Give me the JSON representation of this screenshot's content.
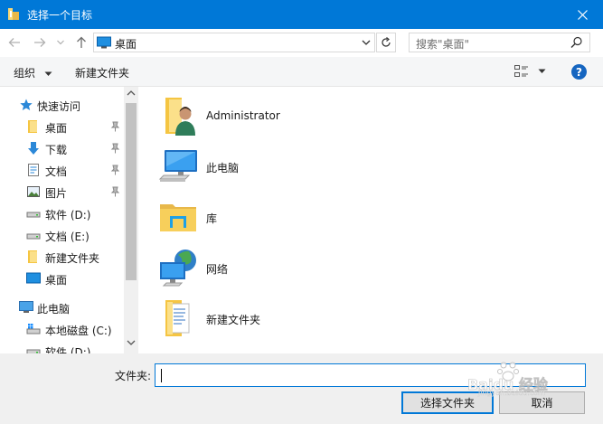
{
  "window": {
    "title": "选择一个目标",
    "close_icon": "close-icon"
  },
  "address_bar": {
    "current_location": "桌面",
    "search_placeholder": "搜索\"桌面\""
  },
  "command_bar": {
    "organize_label": "组织",
    "new_folder_label": "新建文件夹",
    "help_label": "?"
  },
  "nav_pane": {
    "quick_access_label": "快速访问",
    "items": [
      {
        "label": "桌面",
        "icon": "folder-icon",
        "pinned": true
      },
      {
        "label": "下载",
        "icon": "download-icon",
        "pinned": true
      },
      {
        "label": "文档",
        "icon": "document-icon",
        "pinned": true
      },
      {
        "label": "图片",
        "icon": "picture-icon",
        "pinned": true
      },
      {
        "label": "软件 (D:)",
        "icon": "drive-icon",
        "pinned": false
      },
      {
        "label": "文档 (E:)",
        "icon": "drive-icon",
        "pinned": false
      },
      {
        "label": "新建文件夹",
        "icon": "folder-icon",
        "pinned": false
      },
      {
        "label": "桌面",
        "icon": "desktop-icon",
        "pinned": false
      }
    ],
    "this_pc_label": "此电脑",
    "this_pc_items": [
      {
        "label": "本地磁盘 (C:)",
        "icon": "windows-drive-icon"
      },
      {
        "label": "软件 (D:)",
        "icon": "drive-icon"
      }
    ]
  },
  "content": {
    "items": [
      {
        "label": "Administrator",
        "icon": "user-folder-icon"
      },
      {
        "label": "此电脑",
        "icon": "computer-icon"
      },
      {
        "label": "库",
        "icon": "library-icon"
      },
      {
        "label": "网络",
        "icon": "network-icon"
      },
      {
        "label": "新建文件夹",
        "icon": "folder-with-files-icon"
      }
    ]
  },
  "bottom": {
    "folder_label": "文件夹:",
    "folder_value": "",
    "select_button_label": "选择文件夹",
    "cancel_button_label": "取消"
  },
  "watermark": {
    "text": "Baidu 经验",
    "subtext": "jingyan.baidu.com"
  },
  "colors": {
    "title_bar": "#0078d7",
    "accent": "#0078d7",
    "help": "#1565c0"
  }
}
